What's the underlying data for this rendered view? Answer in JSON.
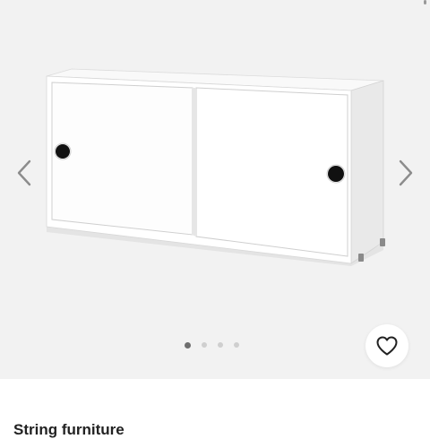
{
  "gallery": {
    "image_alt": "White cabinet with sliding doors",
    "prev_icon": "chevron-left-icon",
    "next_icon": "chevron-right-icon",
    "favorite_icon": "heart-outline-icon",
    "dots": [
      "active",
      "inactive",
      "inactive",
      "inactive"
    ]
  },
  "product": {
    "brand": "String furniture"
  },
  "colors": {
    "gallery_bg": "#f2f2f2",
    "cabinet_white": "#ffffff",
    "dot_active": "#6e6e6e",
    "dot_inactive": "#cfcfcf",
    "text_dark": "#222222"
  }
}
